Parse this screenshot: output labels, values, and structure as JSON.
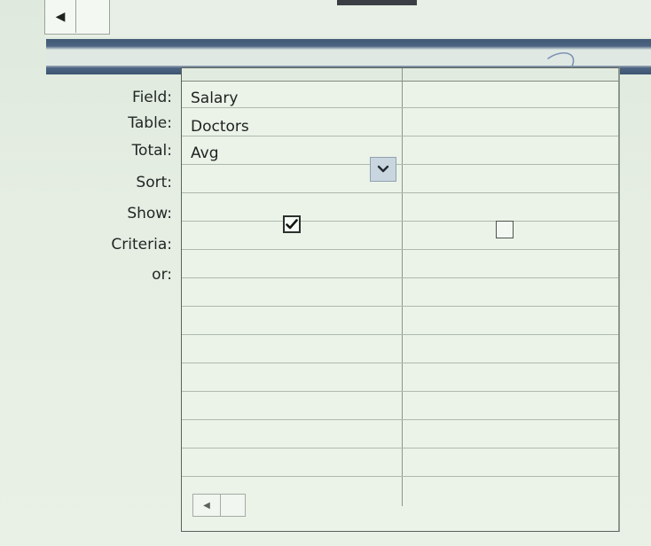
{
  "labels": {
    "field": "Field:",
    "table": "Table:",
    "total": "Total:",
    "sort": "Sort:",
    "show": "Show:",
    "criteria": "Criteria:",
    "or": "or:"
  },
  "columns": [
    {
      "field": "Salary",
      "table": "Doctors",
      "total": "Avg",
      "show": true
    },
    {
      "field": "",
      "table": "",
      "total": "",
      "show": false
    }
  ],
  "icons": {
    "top_scroll_left": "◀",
    "bottom_scroll_left": "◀",
    "dropdown": "chevron-down-icon",
    "checkmark": "check-icon"
  },
  "colors": {
    "splitter": "#4a6180",
    "grid_background": "#ebf2e8"
  }
}
